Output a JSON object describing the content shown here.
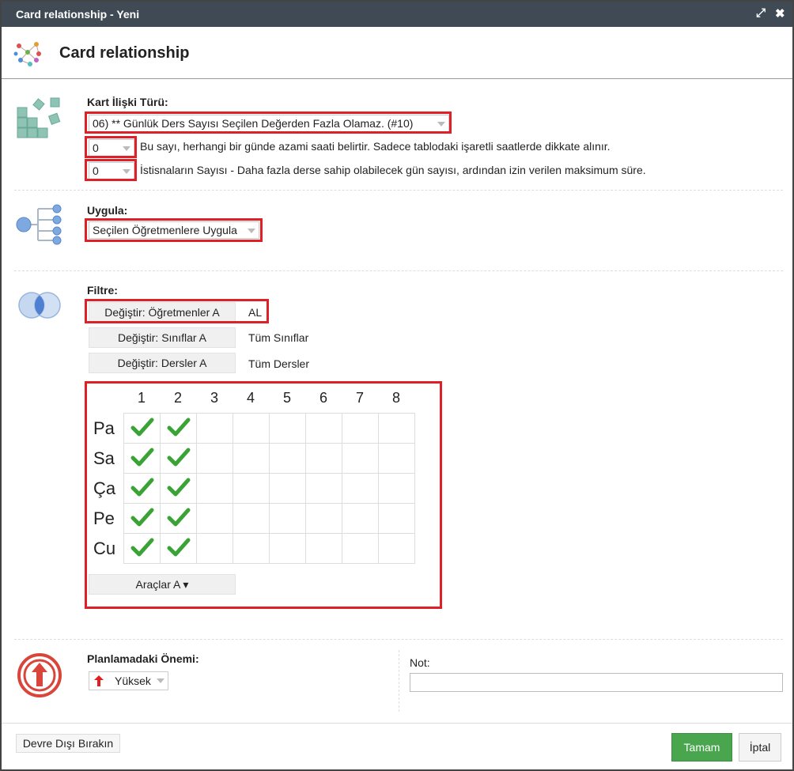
{
  "window": {
    "title": "Card relationship - Yeni",
    "maximize_glyph": "⤢",
    "close_glyph": "✖"
  },
  "header": {
    "title": "Card relationship",
    "icon": "network-graph-icon"
  },
  "relationship": {
    "label": "Kart İlişki Türü:",
    "type_value": "06) ** Günlük Ders Sayısı Seçilen Değerden Fazla Olamaz. (#10)",
    "max_value": "0",
    "max_desc": "Bu sayı, herhangi bir günde azami saati belirtir. Sadece tablodaki işaretli saatlerde dikkate alınır.",
    "exceptions_value": "0",
    "exceptions_desc": "İstisnaların Sayısı - Daha fazla derse sahip olabilecek gün sayısı, ardından izin verilen maksimum süre."
  },
  "apply": {
    "label": "Uygula:",
    "value": "Seçilen Öğretmenlere Uygula"
  },
  "filter": {
    "label": "Filtre:",
    "rows": [
      {
        "button": "Değiştir: Öğretmenler A",
        "value": "AL"
      },
      {
        "button": "Değiştir: Sınıflar A",
        "value": "Tüm Sınıflar"
      },
      {
        "button": "Değiştir: Dersler A",
        "value": "Tüm Dersler"
      }
    ]
  },
  "grid": {
    "columns": [
      "1",
      "2",
      "3",
      "4",
      "5",
      "6",
      "7",
      "8"
    ],
    "rows": [
      {
        "label": "Pa",
        "checked": [
          true,
          true,
          false,
          false,
          false,
          false,
          false,
          false
        ]
      },
      {
        "label": "Sa",
        "checked": [
          true,
          true,
          false,
          false,
          false,
          false,
          false,
          false
        ]
      },
      {
        "label": "Ça",
        "checked": [
          true,
          true,
          false,
          false,
          false,
          false,
          false,
          false
        ]
      },
      {
        "label": "Pe",
        "checked": [
          true,
          true,
          false,
          false,
          false,
          false,
          false,
          false
        ]
      },
      {
        "label": "Cu",
        "checked": [
          true,
          true,
          false,
          false,
          false,
          false,
          false,
          false
        ]
      }
    ],
    "tools_button": "Araçlar A ▾"
  },
  "importance": {
    "label": "Planlamadaki Önemi:",
    "value": "Yüksek",
    "icon": "up-arrow-icon"
  },
  "note": {
    "label": "Not:",
    "value": ""
  },
  "footer": {
    "disable_button": "Devre Dışı Bırakın",
    "ok_button": "Tamam",
    "cancel_button": "İptal"
  },
  "colors": {
    "titlebar": "#3f4a55",
    "highlight": "#e02027",
    "check": "#3aa335",
    "ok_button": "#4aa54f"
  }
}
